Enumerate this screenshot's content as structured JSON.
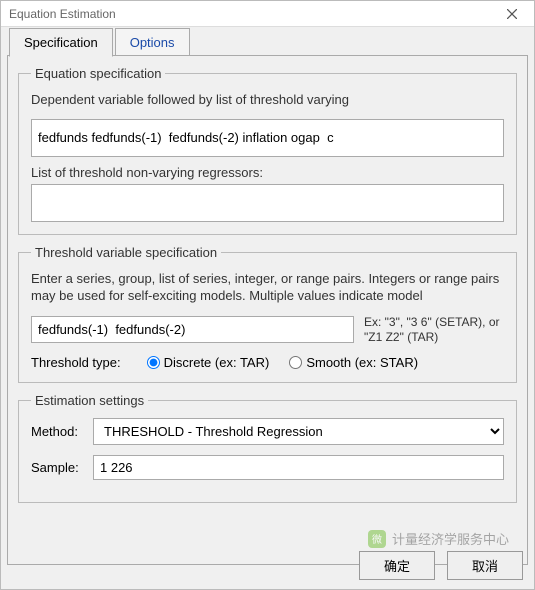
{
  "window": {
    "title": "Equation Estimation"
  },
  "tabs": {
    "spec": "Specification",
    "options": "Options"
  },
  "eqspec": {
    "legend": "Equation specification",
    "desc": "Dependent variable followed by list of threshold varying",
    "value": "fedfunds fedfunds(-1)  fedfunds(-2) inflation ogap  c",
    "nonvary_label": "List of threshold non-varying regressors:",
    "nonvary_value": ""
  },
  "threshvar": {
    "legend": "Threshold variable specification",
    "desc": "Enter a series, group, list of series, integer, or range pairs. Integers or range pairs may be used for self-exciting models. Multiple values indicate model",
    "value": "fedfunds(-1)  fedfunds(-2)",
    "hint": "Ex: \"3\", \"3 6\" (SETAR), or \"Z1 Z2\" (TAR)",
    "type_label": "Threshold type:",
    "radio_discrete": "Discrete (ex: TAR)",
    "radio_smooth": "Smooth (ex: STAR)"
  },
  "est": {
    "legend": "Estimation settings",
    "method_label": "Method:",
    "method_value": "THRESHOLD  -  Threshold Regression",
    "sample_label": "Sample:",
    "sample_value": "1 226"
  },
  "buttons": {
    "ok": "确定",
    "cancel": "取消"
  },
  "watermark": {
    "text": "计量经济学服务中心"
  }
}
